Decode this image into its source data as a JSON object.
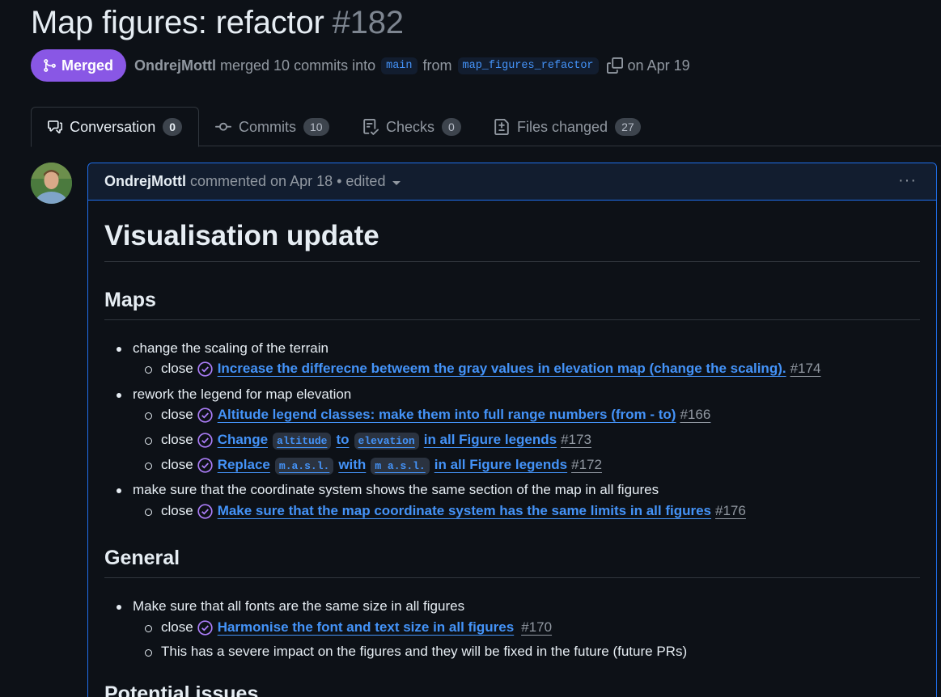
{
  "pr": {
    "title": "Map figures: refactor",
    "number": "#182",
    "state": "Merged",
    "author": "OndrejMottl",
    "action": "merged 10 commits into",
    "base_branch": "main",
    "from_word": "from",
    "head_branch": "map_figures_refactor",
    "merged_date": "on Apr 19"
  },
  "tabs": [
    {
      "label": "Conversation",
      "count": "0",
      "icon": "comment-discussion-icon"
    },
    {
      "label": "Commits",
      "count": "10",
      "icon": "git-commit-icon"
    },
    {
      "label": "Checks",
      "count": "0",
      "icon": "checklist-icon"
    },
    {
      "label": "Files changed",
      "count": "27",
      "icon": "file-diff-icon"
    }
  ],
  "comment": {
    "author": "OndrejMottl",
    "meta": "commented on Apr 18 • edited",
    "menu": "···",
    "heading": "Visualisation update",
    "sections": [
      {
        "title": "Maps",
        "items": [
          {
            "text": "change the scaling of the terrain",
            "subitems": [
              {
                "prefix": "close",
                "link_parts": [
                  "Increase the differecne betweem the gray values in elevation map (change the scaling)."
                ],
                "number": "#174"
              }
            ]
          },
          {
            "text": "rework the legend for map elevation",
            "subitems": [
              {
                "prefix": "close",
                "link_parts": [
                  "Altitude legend classes: make them into full range numbers (from - to)"
                ],
                "number": "#166"
              },
              {
                "prefix": "close",
                "link_parts": [
                  "Change",
                  "altitude",
                  "to",
                  "elevation",
                  "in all Figure legends"
                ],
                "number": "#173"
              },
              {
                "prefix": "close",
                "link_parts": [
                  "Replace",
                  "m.a.s.l.",
                  "with",
                  "m a.s.l.",
                  "in all Figure legends"
                ],
                "number": "#172"
              }
            ]
          },
          {
            "text": "make sure that the coordinate system shows the same section of the map in all figures",
            "subitems": [
              {
                "prefix": "close",
                "link_parts": [
                  "Make sure that the map coordinate system has the same limits in all figures"
                ],
                "number": "#176"
              }
            ]
          }
        ]
      },
      {
        "title": "General",
        "items": [
          {
            "text": "Make sure that all fonts are the same size in all figures",
            "subitems": [
              {
                "prefix": "close",
                "link_parts": [
                  "Harmonise the font and text size in all figures"
                ],
                "number": "#170"
              },
              {
                "plain": "This has a severe impact on the figures and they will be fixed in the future (future PRs)"
              }
            ]
          }
        ]
      },
      {
        "title": "Potential issues",
        "items": []
      }
    ]
  },
  "colors": {
    "background": "#0d1117",
    "merged_badge": "#8957e5",
    "link": "#4493f8",
    "muted": "#9198a1",
    "comment_border": "#1f6feb",
    "comment_header_bg": "#121d2f"
  }
}
